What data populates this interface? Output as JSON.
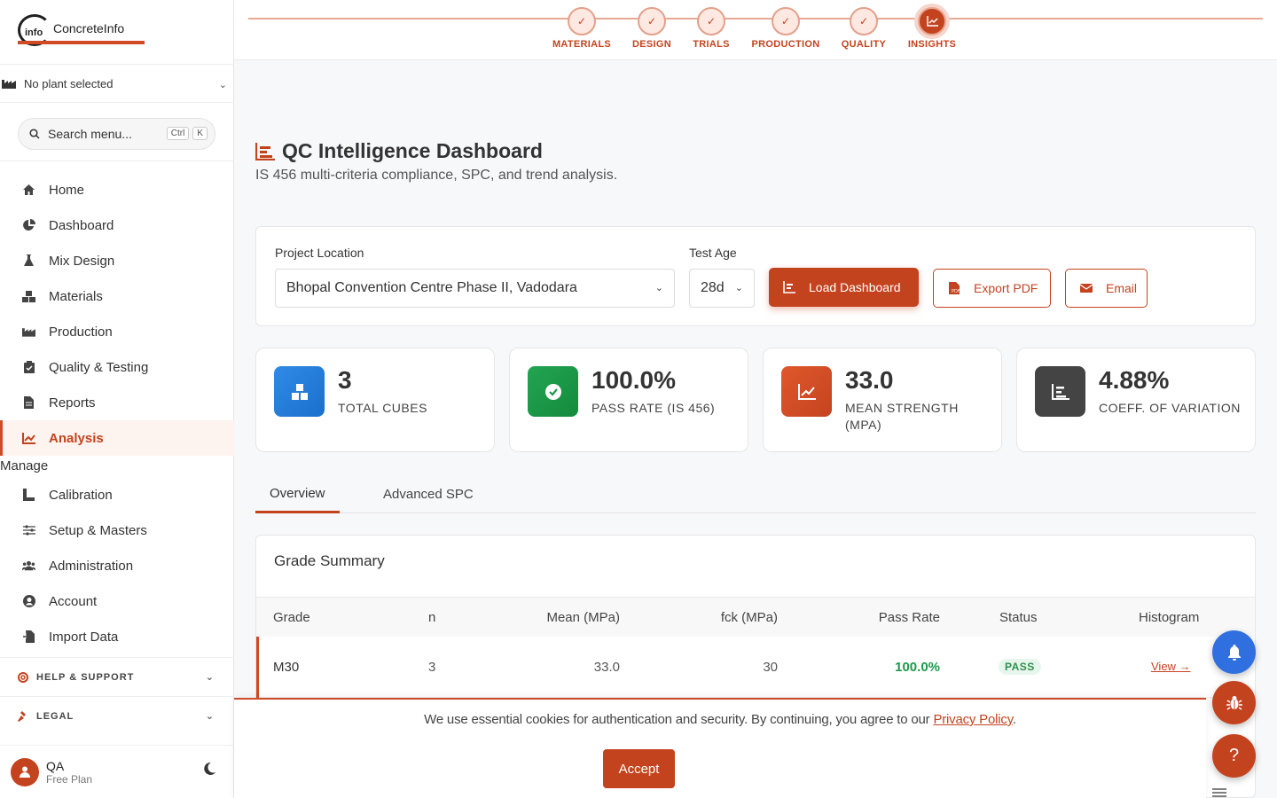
{
  "brand": {
    "name": "ConcreteInfo",
    "logo_mark": "info"
  },
  "colors": {
    "accent": "#c4431f",
    "blue": "#2f6fe0",
    "green": "#1a9a4a",
    "dark": "#444444"
  },
  "sidebar": {
    "plant_selector": "No plant selected",
    "search": {
      "placeholder": "Search menu...",
      "shortcut_1": "Ctrl",
      "shortcut_2": "K"
    },
    "items": [
      {
        "label": "Home",
        "icon": "home-icon"
      },
      {
        "label": "Dashboard",
        "icon": "pie-chart-icon"
      },
      {
        "label": "Mix Design",
        "icon": "flask-icon"
      },
      {
        "label": "Materials",
        "icon": "cubes-icon"
      },
      {
        "label": "Production",
        "icon": "industry-icon"
      },
      {
        "label": "Quality & Testing",
        "icon": "clipboard-check-icon"
      },
      {
        "label": "Reports",
        "icon": "file-icon"
      },
      {
        "label": "Analysis",
        "icon": "line-chart-icon",
        "active": true
      }
    ],
    "manage_label": "Manage",
    "manage_items": [
      {
        "label": "Calibration",
        "icon": "ruler-icon"
      },
      {
        "label": "Setup & Masters",
        "icon": "sliders-icon"
      },
      {
        "label": "Administration",
        "icon": "users-icon"
      },
      {
        "label": "Account",
        "icon": "user-circle-icon"
      },
      {
        "label": "Import Data",
        "icon": "file-import-icon"
      }
    ],
    "help_label": "HELP & SUPPORT",
    "legal_label": "LEGAL",
    "user": {
      "name": "QA",
      "plan": "Free Plan"
    }
  },
  "stepper": {
    "steps": [
      {
        "label": "MATERIALS"
      },
      {
        "label": "DESIGN"
      },
      {
        "label": "TRIALS"
      },
      {
        "label": "PRODUCTION"
      },
      {
        "label": "QUALITY"
      },
      {
        "label": "INSIGHTS",
        "current": true
      }
    ]
  },
  "page": {
    "title": "QC Intelligence Dashboard",
    "subtitle": "IS 456 multi-criteria compliance, SPC, and trend analysis."
  },
  "filters": {
    "project_label": "Project Location",
    "project_value": "Bhopal Convention Centre Phase II, Vadodara",
    "age_label": "Test Age",
    "age_value": "28d",
    "load_button": "Load Dashboard",
    "export_button": "Export PDF",
    "email_button": "Email"
  },
  "stats": [
    {
      "value": "3",
      "label": "TOTAL CUBES"
    },
    {
      "value": "100.0%",
      "label": "PASS RATE (IS 456)"
    },
    {
      "value": "33.0",
      "label": "MEAN STRENGTH (MPA)"
    },
    {
      "value": "4.88%",
      "label": "COEFF. OF VARIATION"
    }
  ],
  "tabs": [
    {
      "label": "Overview",
      "active": true
    },
    {
      "label": "Advanced SPC"
    }
  ],
  "grade_summary": {
    "title": "Grade Summary",
    "columns": [
      "Grade",
      "n",
      "Mean (MPa)",
      "fck (MPa)",
      "Pass Rate",
      "Status",
      "Histogram"
    ],
    "rows": [
      {
        "grade": "M30",
        "n": "3",
        "mean": "33.0",
        "fck": "30",
        "pass_rate": "100.0%",
        "status": "PASS",
        "histogram": "View →"
      }
    ]
  },
  "cookie": {
    "text": "We use essential cookies for authentication and security. By continuing, you agree to our ",
    "link": "Privacy Policy",
    "end": ".",
    "accept": "Accept"
  },
  "fab": {
    "help": "?"
  }
}
